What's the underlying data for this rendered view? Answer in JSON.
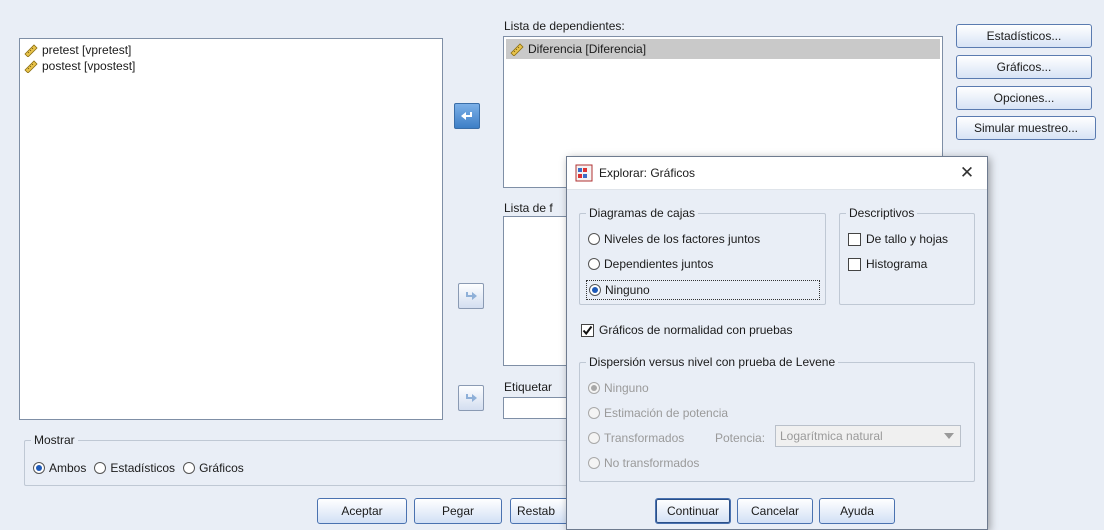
{
  "source_list": {
    "items": [
      {
        "label": "pretest [vpretest]",
        "icon": "scale-ruler-icon"
      },
      {
        "label": "postest [vpostest]",
        "icon": "scale-ruler-icon"
      }
    ]
  },
  "dependents": {
    "label": "Lista de dependientes:",
    "items": [
      {
        "label": "Diferencia [Diferencia]",
        "icon": "scale-ruler-icon"
      }
    ]
  },
  "factors": {
    "label": "Lista de f"
  },
  "label_cases": {
    "label": "Etiquetar"
  },
  "side_buttons": [
    "Estadísticos...",
    "Gráficos...",
    "Opciones...",
    "Simular muestreo..."
  ],
  "display": {
    "title": "Mostrar",
    "options": [
      {
        "label": "Ambos",
        "selected": true
      },
      {
        "label": "Estadísticos",
        "selected": false
      },
      {
        "label": "Gráficos",
        "selected": false
      }
    ]
  },
  "bottom_buttons": [
    "Aceptar",
    "Pegar",
    "Restab"
  ],
  "dialog": {
    "title": "Explorar: Gráficos",
    "boxplots": {
      "title": "Diagramas de cajas",
      "options": [
        {
          "label": "Niveles de los factores juntos",
          "selected": false
        },
        {
          "label": "Dependientes juntos",
          "selected": false
        },
        {
          "label": "Ninguno",
          "selected": true
        }
      ]
    },
    "descriptives": {
      "title": "Descriptivos",
      "options": [
        {
          "label": "De tallo y hojas",
          "checked": false
        },
        {
          "label": "Histograma",
          "checked": false
        }
      ]
    },
    "normality": {
      "label": "Gráficos de normalidad con pruebas",
      "checked": true
    },
    "levene": {
      "title": "Dispersión versus nivel con prueba de Levene",
      "options": [
        {
          "label": "Ninguno",
          "selected": true
        },
        {
          "label": "Estimación de potencia",
          "selected": false
        },
        {
          "label": "Transformados",
          "selected": false
        },
        {
          "label": "No transformados",
          "selected": false
        }
      ],
      "power_label": "Potencia:",
      "power_value": "Logarítmica natural"
    },
    "buttons": [
      "Continuar",
      "Cancelar",
      "Ayuda"
    ]
  },
  "colors": {
    "background": "#e9eef6",
    "accent": "#3d7fc6"
  }
}
